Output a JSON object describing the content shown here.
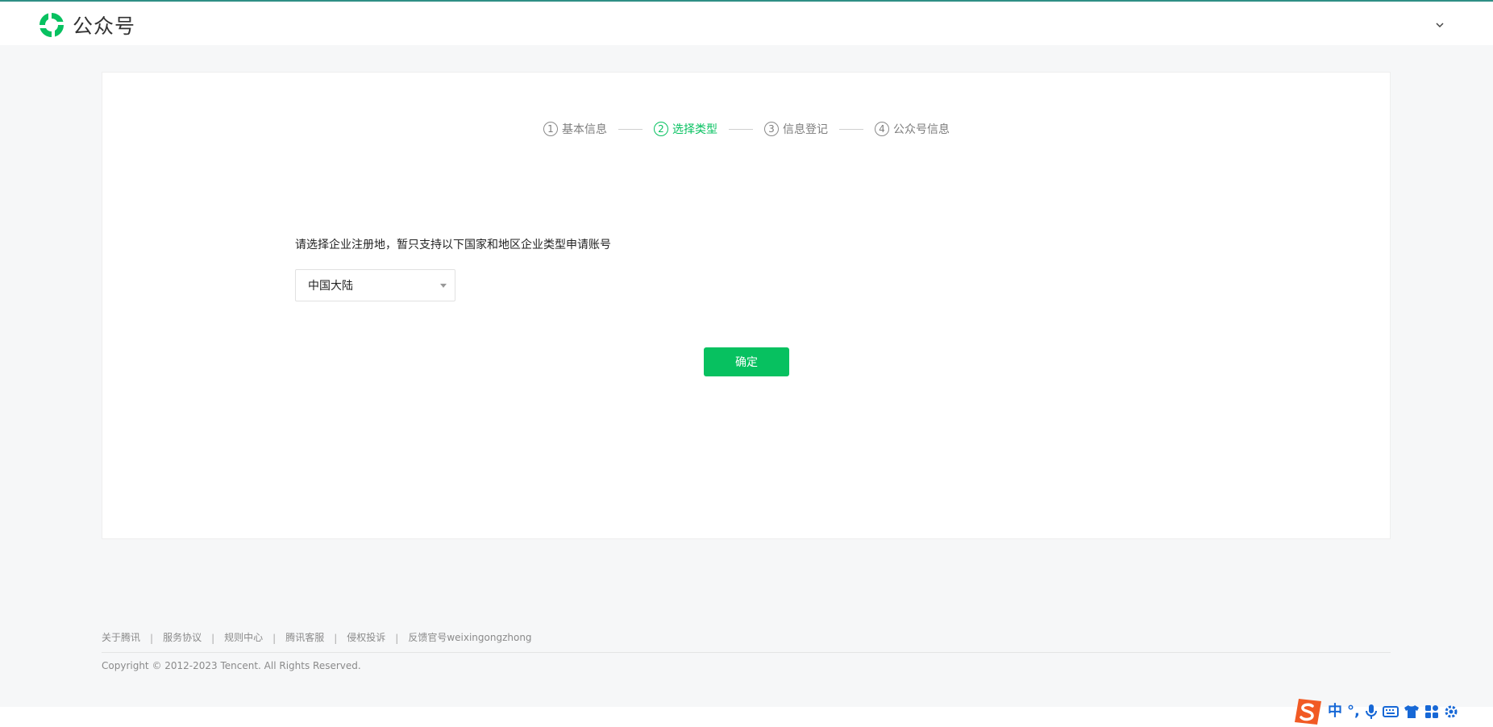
{
  "header": {
    "brand_text": "公众号",
    "logo_icon": "wechat-mp-logo",
    "user_menu_icon": "chevron-down-icon"
  },
  "steps": [
    {
      "number": "1",
      "label": "基本信息",
      "active": false
    },
    {
      "number": "2",
      "label": "选择类型",
      "active": true
    },
    {
      "number": "3",
      "label": "信息登记",
      "active": false
    },
    {
      "number": "4",
      "label": "公众号信息",
      "active": false
    }
  ],
  "form": {
    "prompt": "请选择企业注册地，暂只支持以下国家和地区企业类型申请账号",
    "region_select_value": "中国大陆",
    "confirm_label": "确定"
  },
  "footer": {
    "links": [
      "关于腾讯",
      "服务协议",
      "规则中心",
      "腾讯客服",
      "侵权投诉",
      "反馈官号weixingongzhong"
    ],
    "copyright": "Copyright © 2012-2023 Tencent. All Rights Reserved."
  },
  "ime_toolbar": {
    "mode_label": "中",
    "punct_label": "°,",
    "icons": [
      "sogou-logo",
      "microphone-icon",
      "keyboard-icon",
      "skin-icon",
      "apps-icon",
      "settings-icon"
    ]
  },
  "colors": {
    "accent": "#07c160",
    "top_line": "#2f8f85",
    "background": "#f6f7f8",
    "ime_blue": "#1768d6",
    "ime_logo": "#f15a24"
  }
}
